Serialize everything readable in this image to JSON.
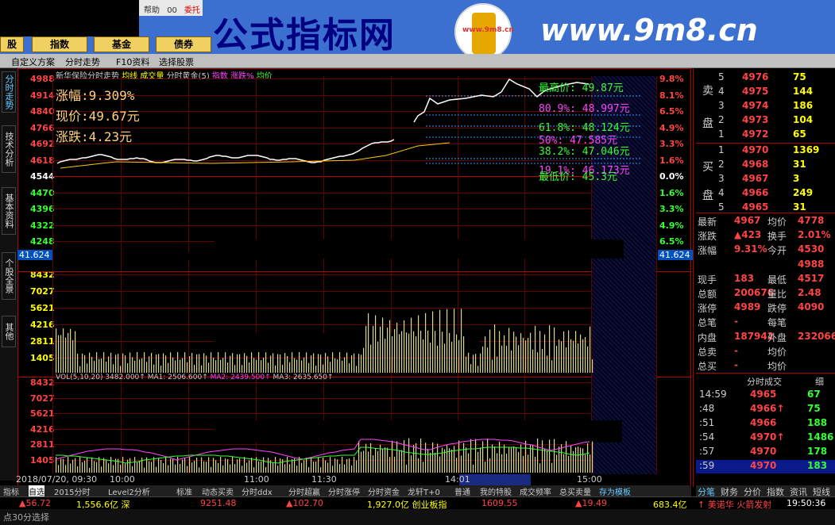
{
  "banner": {
    "menu_help": "帮助",
    "menu_help_code": "00",
    "menu_delegate": "委托",
    "site_title": "公式指标网",
    "site_url": "www.9m8.cn",
    "logo_text": "www.9m8.cn"
  },
  "top_buttons": [
    "股",
    "指数",
    "基金",
    "债券"
  ],
  "toolbar": {
    "custom_scheme": "自定义方案",
    "intraday_trend": "分时走势",
    "f10": "F10资料",
    "select_stock": "选择股票"
  },
  "vertical_tabs": [
    "分时走势",
    "技术分析",
    "基本资料",
    "个股全景",
    "其他"
  ],
  "chart_header": {
    "stock_title": "新华保险分时走势",
    "avg_line": "均线",
    "volume": "成交量",
    "golden": "分时黄金(5)",
    "index": "指数",
    "pct": "涨跌%",
    "avg_price": "均价"
  },
  "info": {
    "change_pct": "涨幅:9.309%",
    "price": "现价:49.67元",
    "change": "涨跌:4.23元"
  },
  "fib_labels": [
    {
      "text": "最高价:   49.87元",
      "color": "#33ff33"
    },
    {
      "text": "80.9%: 48.997元",
      "color": "#ff44ff"
    },
    {
      "text": "61.8%: 48.124元",
      "color": "#33ff33"
    },
    {
      "text": "50%:  47.585元",
      "color": "#ff44ff"
    },
    {
      "text": "38.2%: 47.046元",
      "color": "#33ff33"
    },
    {
      "text": "19.1%: 46.173元",
      "color": "#ff44ff"
    },
    {
      "text": "最低价:  45.3元",
      "color": "#33ff33"
    }
  ],
  "price_axis_left": [
    "4988",
    "4914",
    "4840",
    "4766",
    "4692",
    "4618",
    "4544",
    "4470",
    "4396",
    "4322",
    "4248"
  ],
  "price_axis_right": [
    "9.8%",
    "8.1%",
    "6.5%",
    "4.9%",
    "3.3%",
    "1.6%",
    "0.0%",
    "1.6%",
    "3.3%",
    "4.9%",
    "6.5%"
  ],
  "crosshair_value": "41.624",
  "volume_axis": [
    "8432",
    "7027",
    "5621",
    "4216",
    "2811",
    "1405"
  ],
  "volume_axis_lower": [
    "8432",
    "7027",
    "5621",
    "4216",
    "2811",
    "1405"
  ],
  "vol_legend": {
    "vol": "VOL(5,10,20) 3482.000↑",
    "ma1": "MA1: 2506.600↑",
    "ma2": "MA2: 2439.500↑",
    "ma3": "MA3: 2635.650↑"
  },
  "time_axis": {
    "date": "2018/07/20, 09:30",
    "t1": "10:00",
    "t2": "11:00",
    "t3": "11:30",
    "t4": "14:01",
    "t5": "15:00"
  },
  "order_book": {
    "sell_label_top": "卖",
    "sell_label_bottom": "盘",
    "buy_label_top": "买",
    "buy_label_bottom": "盘",
    "sell": [
      {
        "n": "5",
        "price": "4976",
        "vol": "75"
      },
      {
        "n": "4",
        "price": "4975",
        "vol": "144"
      },
      {
        "n": "3",
        "price": "4974",
        "vol": "186"
      },
      {
        "n": "2",
        "price": "4973",
        "vol": "104"
      },
      {
        "n": "1",
        "price": "4972",
        "vol": "65"
      }
    ],
    "buy": [
      {
        "n": "1",
        "price": "4970",
        "vol": "1369"
      },
      {
        "n": "2",
        "price": "4968",
        "vol": "31"
      },
      {
        "n": "3",
        "price": "4967",
        "vol": "3"
      },
      {
        "n": "4",
        "price": "4966",
        "vol": "249"
      },
      {
        "n": "5",
        "price": "4965",
        "vol": "31"
      }
    ]
  },
  "quote": [
    {
      "l1": "最新",
      "v1": "4967",
      "l2": "均价",
      "v2": "4778"
    },
    {
      "l1": "涨跌",
      "v1": "▲423",
      "l2": "换手",
      "v2": "2.01%"
    },
    {
      "l1": "涨幅",
      "v1": "9.31%",
      "l2": "今开",
      "v2": "4530"
    },
    {
      "l1": "",
      "v1": "",
      "l2": "",
      "v2": "4988"
    },
    {
      "l1": "现手",
      "v1": "183",
      "l2": "最低",
      "v2": "4517"
    },
    {
      "l1": "总额",
      "v1": "200676",
      "l2": "量比",
      "v2": "2.48"
    },
    {
      "l1": "涨停",
      "v1": "4989",
      "l2": "跌停",
      "v2": "4090"
    },
    {
      "l1": "总笔",
      "v1": "-",
      "l2": "每笔",
      "v2": ""
    },
    {
      "l1": "内盘",
      "v1": "187942",
      "l2": "外盘",
      "v2": "232066"
    },
    {
      "l1": "总卖",
      "v1": "-",
      "l2": "均价",
      "v2": ""
    },
    {
      "l1": "总买",
      "v1": "-",
      "l2": "均价",
      "v2": ""
    }
  ],
  "ticks_header": {
    "title": "分时成交",
    "detail": "细"
  },
  "ticks": [
    {
      "time": "14:59",
      "price": "4965",
      "vol": "67"
    },
    {
      "time": ":48",
      "price": "4966↑",
      "vol": "75"
    },
    {
      "time": ":51",
      "price": "4966",
      "vol": "188"
    },
    {
      "time": ":54",
      "price": "4970↑",
      "vol": "1486"
    },
    {
      "time": ":57",
      "price": "4970",
      "vol": "178"
    },
    {
      "time": ":59",
      "price": "4970",
      "vol": "183"
    }
  ],
  "right_tabs": [
    "分笔",
    "财务",
    "分价",
    "指数",
    "资讯",
    "短线"
  ],
  "bottom_tabs": [
    "指标",
    "自选",
    "2015分时",
    "Level2分析",
    "标准",
    "动态买卖",
    "分时ddx",
    "分时超赢",
    "分时涨停",
    "分时资金",
    "龙轩T+0",
    "普通",
    "我的特股",
    "成交频率",
    "总买卖量",
    "存为模板"
  ],
  "status": {
    "s1": "▲56.72",
    "s2": "1,556.6亿 深",
    "s3": "9251.48",
    "s4": "▲102.70",
    "s5": "1,927.0亿 创业板指",
    "s6": "1609.55",
    "s7": "▲19.49",
    "s8": "683.4亿",
    "s9": "↑ 美诺华 火箭发射",
    "s10": "19:50:36"
  },
  "footer_text": "点30分选择"
}
